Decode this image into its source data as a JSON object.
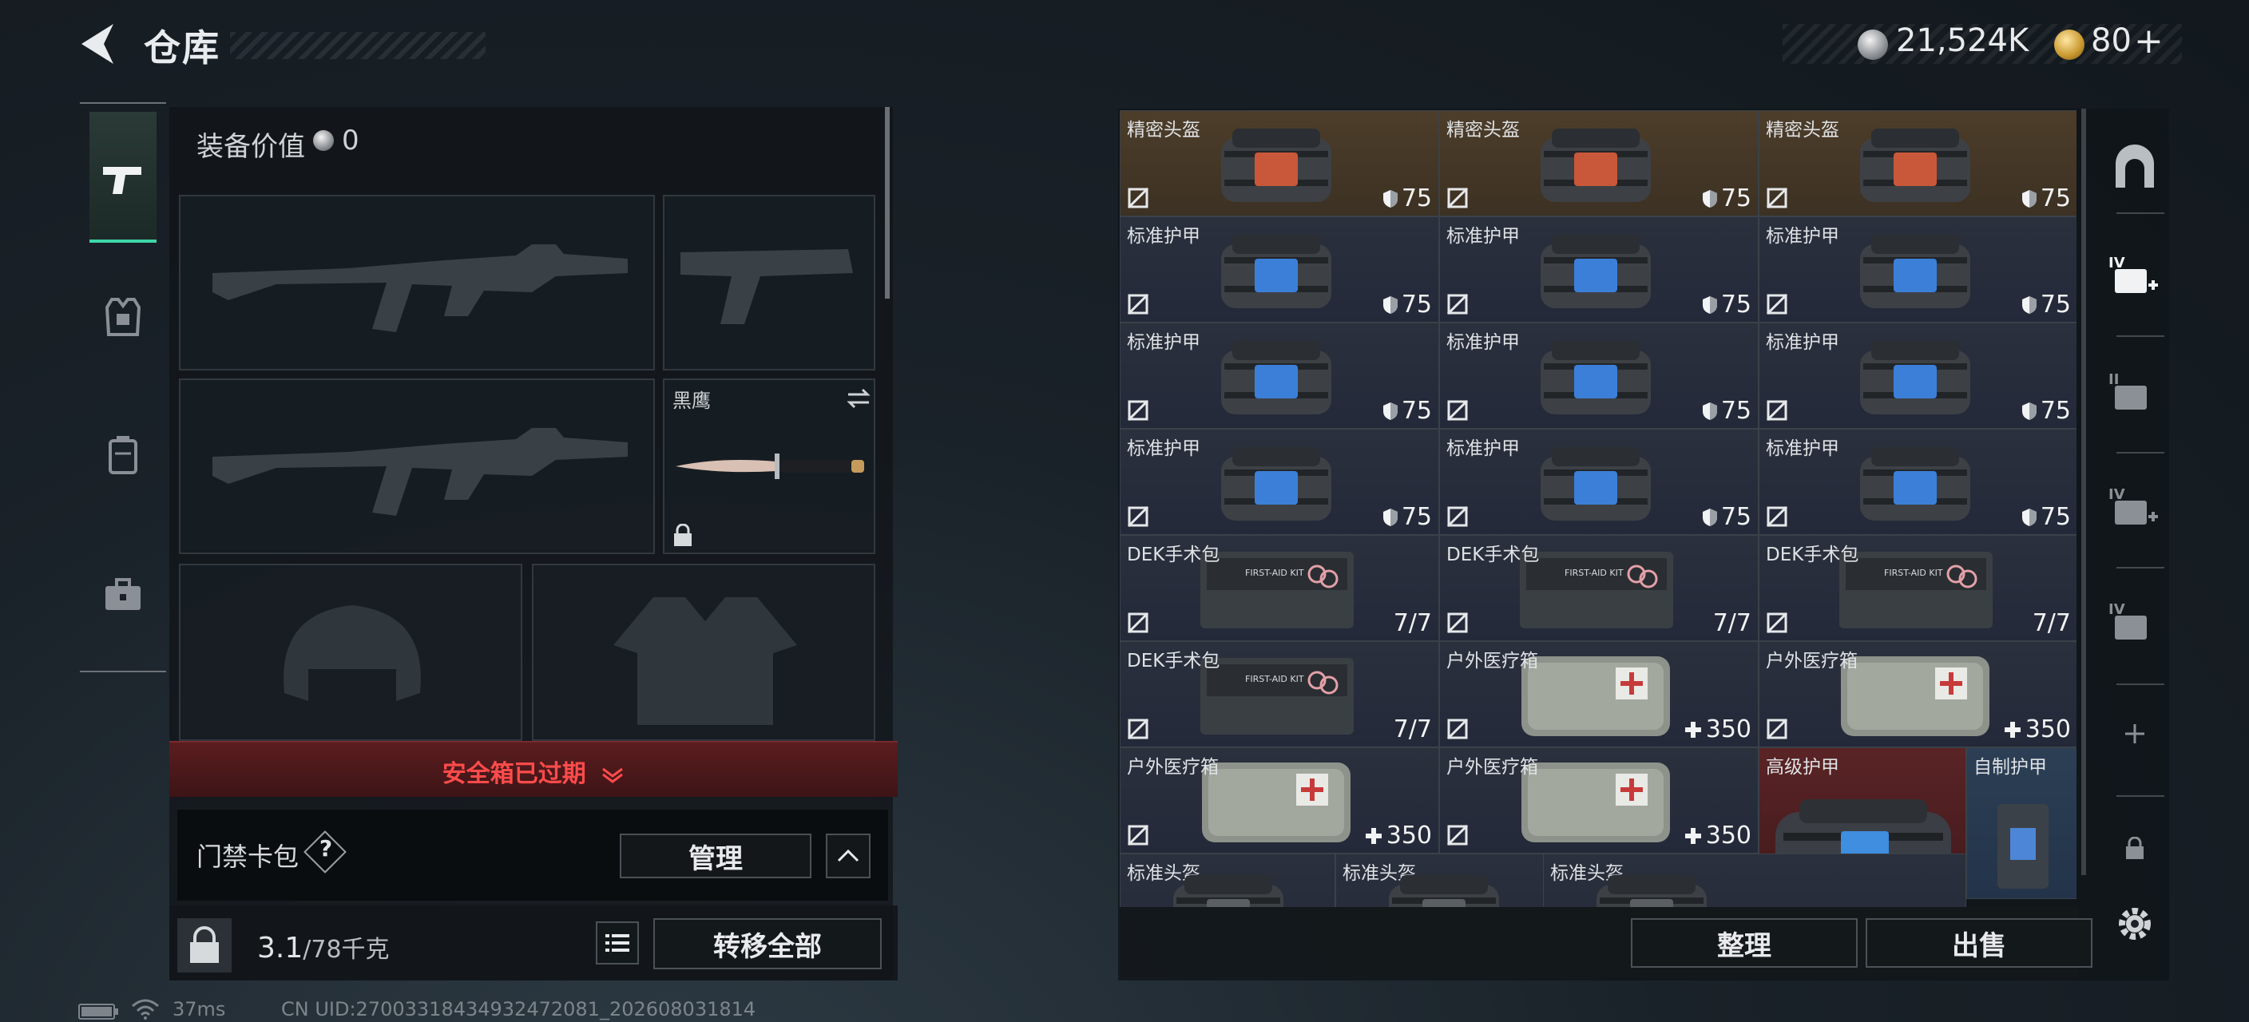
{
  "header": {
    "title": "仓库",
    "silver_amount": "21,524K",
    "gold_amount": "80",
    "gold_plus": "+"
  },
  "left_panel": {
    "equipment_value_label": "装备价值",
    "equipment_value": "0",
    "knife_name": "黑鹰",
    "safe_box_expired": "安全箱已过期",
    "keycard_bag_label": "门禁卡包",
    "keycard_help": "?",
    "manage_button": "管理",
    "weight_current": "3.1",
    "weight_total": "/78千克",
    "transfer_all_button": "转移全部"
  },
  "inventory": {
    "rows": [
      [
        {
          "name": "精密头盔",
          "value": "75",
          "kind": "helmet"
        },
        {
          "name": "精密头盔",
          "value": "75",
          "kind": "helmet"
        },
        {
          "name": "精密头盔",
          "value": "75",
          "kind": "helmet"
        }
      ],
      [
        {
          "name": "标准护甲",
          "value": "75",
          "kind": "armor"
        },
        {
          "name": "标准护甲",
          "value": "75",
          "kind": "armor"
        },
        {
          "name": "标准护甲",
          "value": "75",
          "kind": "armor"
        }
      ],
      [
        {
          "name": "标准护甲",
          "value": "75",
          "kind": "armor"
        },
        {
          "name": "标准护甲",
          "value": "75",
          "kind": "armor"
        },
        {
          "name": "标准护甲",
          "value": "75",
          "kind": "armor"
        }
      ],
      [
        {
          "name": "标准护甲",
          "value": "75",
          "kind": "armor"
        },
        {
          "name": "标准护甲",
          "value": "75",
          "kind": "armor"
        },
        {
          "name": "标准护甲",
          "value": "75",
          "kind": "armor"
        }
      ],
      [
        {
          "name": "DEK手术包",
          "value": "7/7",
          "kind": "surgery"
        },
        {
          "name": "DEK手术包",
          "value": "7/7",
          "kind": "surgery"
        },
        {
          "name": "DEK手术包",
          "value": "7/7",
          "kind": "surgery"
        }
      ],
      [
        {
          "name": "DEK手术包",
          "value": "7/7",
          "kind": "surgery"
        },
        {
          "name": "户外医疗箱",
          "value": "350",
          "kind": "medkit"
        },
        {
          "name": "户外医疗箱",
          "value": "350",
          "kind": "medkit"
        }
      ],
      [
        {
          "name": "户外医疗箱",
          "value": "350",
          "kind": "medkit"
        },
        {
          "name": "户外医疗箱",
          "value": "350",
          "kind": "medkit"
        },
        {
          "name": "高级护甲",
          "value": "",
          "kind": "advanced"
        }
      ]
    ],
    "extra_cell_name": "自制护甲",
    "partial_row": [
      "标准头盔",
      "标准头盔",
      "标准头盔"
    ]
  },
  "footer": {
    "sort_button": "整理",
    "sell_button": "出售"
  },
  "status_bar": {
    "ping": "37ms",
    "uid_text": "CN UID:27003318434932472081_202608031814"
  },
  "colors": {
    "accent_green": "#3fd6a8",
    "expired_red": "#ff4b4b",
    "gold_row": "#4d3d2a",
    "red_cell": "#5a2426"
  }
}
